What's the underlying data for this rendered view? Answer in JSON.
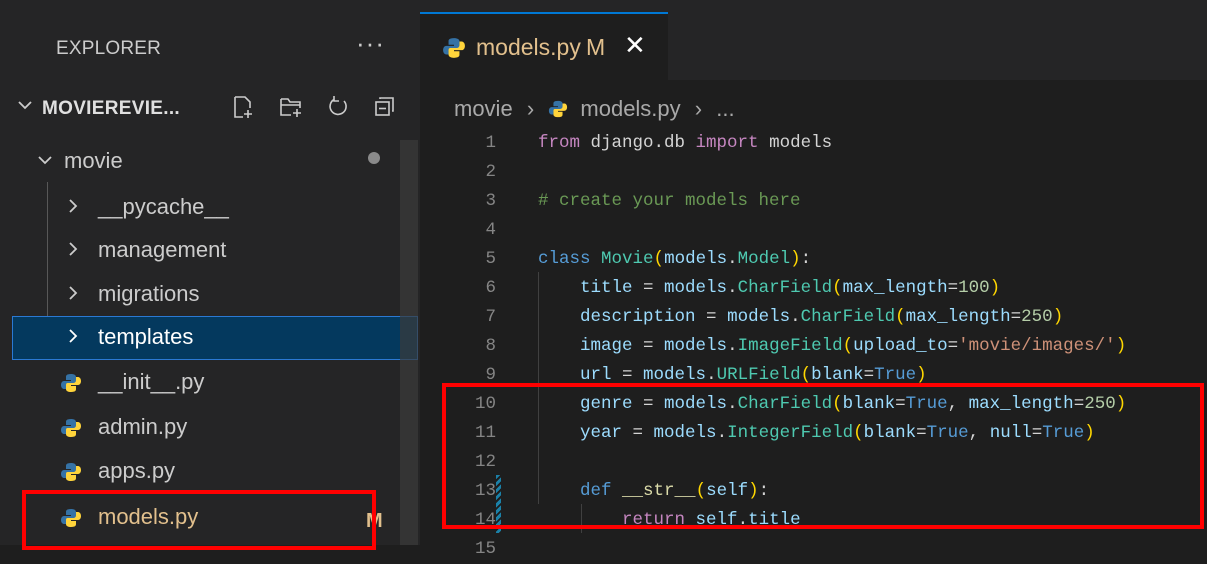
{
  "sidebar": {
    "title": "EXPLORER",
    "more": "···",
    "project": "MOVIEREVIE...",
    "tree": [
      {
        "label": "movie",
        "type": "folder-open"
      },
      {
        "label": "__pycache__",
        "type": "folder"
      },
      {
        "label": "management",
        "type": "folder"
      },
      {
        "label": "migrations",
        "type": "folder"
      },
      {
        "label": "templates",
        "type": "folder",
        "selected": true
      },
      {
        "label": "__init__.py",
        "type": "python"
      },
      {
        "label": "admin.py",
        "type": "python"
      },
      {
        "label": "apps.py",
        "type": "python"
      },
      {
        "label": "models.py",
        "type": "python",
        "badge": "M"
      }
    ]
  },
  "tab": {
    "label": "models.py",
    "modified": "M",
    "close": "✕"
  },
  "breadcrumb": {
    "folder": "movie",
    "sep": "›",
    "file": "models.py",
    "ellipsis": "..."
  },
  "code": {
    "line_numbers": [
      "1",
      "2",
      "3",
      "4",
      "5",
      "6",
      "7",
      "8",
      "9",
      "10",
      "11",
      "12",
      "13",
      "14",
      "15"
    ]
  },
  "colors": {
    "accent": "#0078d4",
    "modified": "#e2c08d",
    "highlight": "#ff0000",
    "python_blue": "#3572a5",
    "python_yellow": "#ffd43b"
  }
}
